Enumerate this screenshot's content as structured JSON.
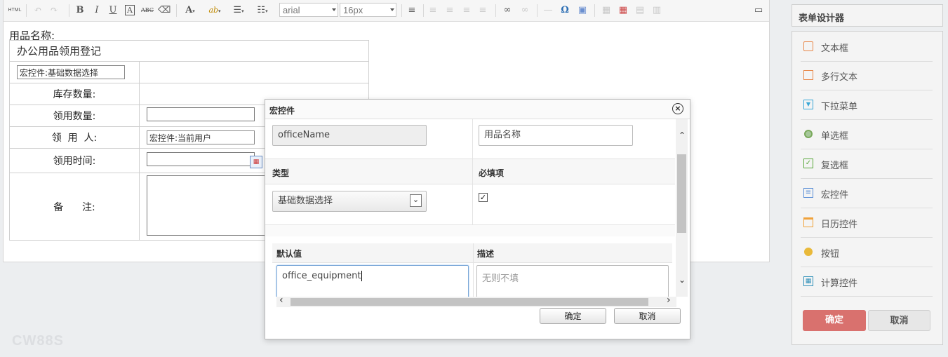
{
  "toolbar": {
    "html_label": "HTML",
    "bold": "B",
    "italic": "I",
    "underline": "U",
    "strike": "ABC",
    "font_color": "A",
    "highlight": "ab",
    "font_family": "arial",
    "font_size": "16px",
    "omega": "Ω"
  },
  "form": {
    "title_label": "用品名称:",
    "table_title": "办公用品领用登记",
    "macro_basic": "宏控件:基础数据选择",
    "rows": [
      {
        "label": "库存数量:"
      },
      {
        "label": "领用数量:"
      },
      {
        "label": "领  用  人:",
        "value": "宏控件:当前用户"
      },
      {
        "label": "领用时间:"
      },
      {
        "label": "备      注:"
      }
    ]
  },
  "dialog": {
    "title": "宏控件",
    "name_value": "officeName",
    "title_value": "用品名称",
    "type_header": "类型",
    "required_header": "必填项",
    "type_value": "基础数据选择",
    "required_checked": true,
    "default_header": "默认值",
    "desc_header": "描述",
    "default_value": "office_equipment",
    "desc_placeholder": "无则不填",
    "ok": "确定",
    "cancel": "取消"
  },
  "panel": {
    "header": "表单设计器",
    "items": [
      {
        "label": "文本框",
        "icon": "textbox-icon",
        "color": "#e8894b"
      },
      {
        "label": "多行文本",
        "icon": "textarea-icon",
        "color": "#e8894b"
      },
      {
        "label": "下拉菜单",
        "icon": "dropdown-icon",
        "color": "#3aa7d6"
      },
      {
        "label": "单选框",
        "icon": "radio-icon",
        "color": "#7aa95c"
      },
      {
        "label": "复选框",
        "icon": "checkbox-icon",
        "color": "#5aa83c"
      },
      {
        "label": "宏控件",
        "icon": "macro-icon",
        "color": "#5b8fd6"
      },
      {
        "label": "日历控件",
        "icon": "calendar-icon",
        "color": "#f0a23a"
      },
      {
        "label": "按钮",
        "icon": "button-icon",
        "color": "#e9b93a"
      },
      {
        "label": "计算控件",
        "icon": "calculator-icon",
        "color": "#2e8fb8"
      }
    ],
    "confirm": "确定",
    "cancel": "取消",
    "confirm_color": "#d9716e"
  },
  "watermark": "CW88S"
}
